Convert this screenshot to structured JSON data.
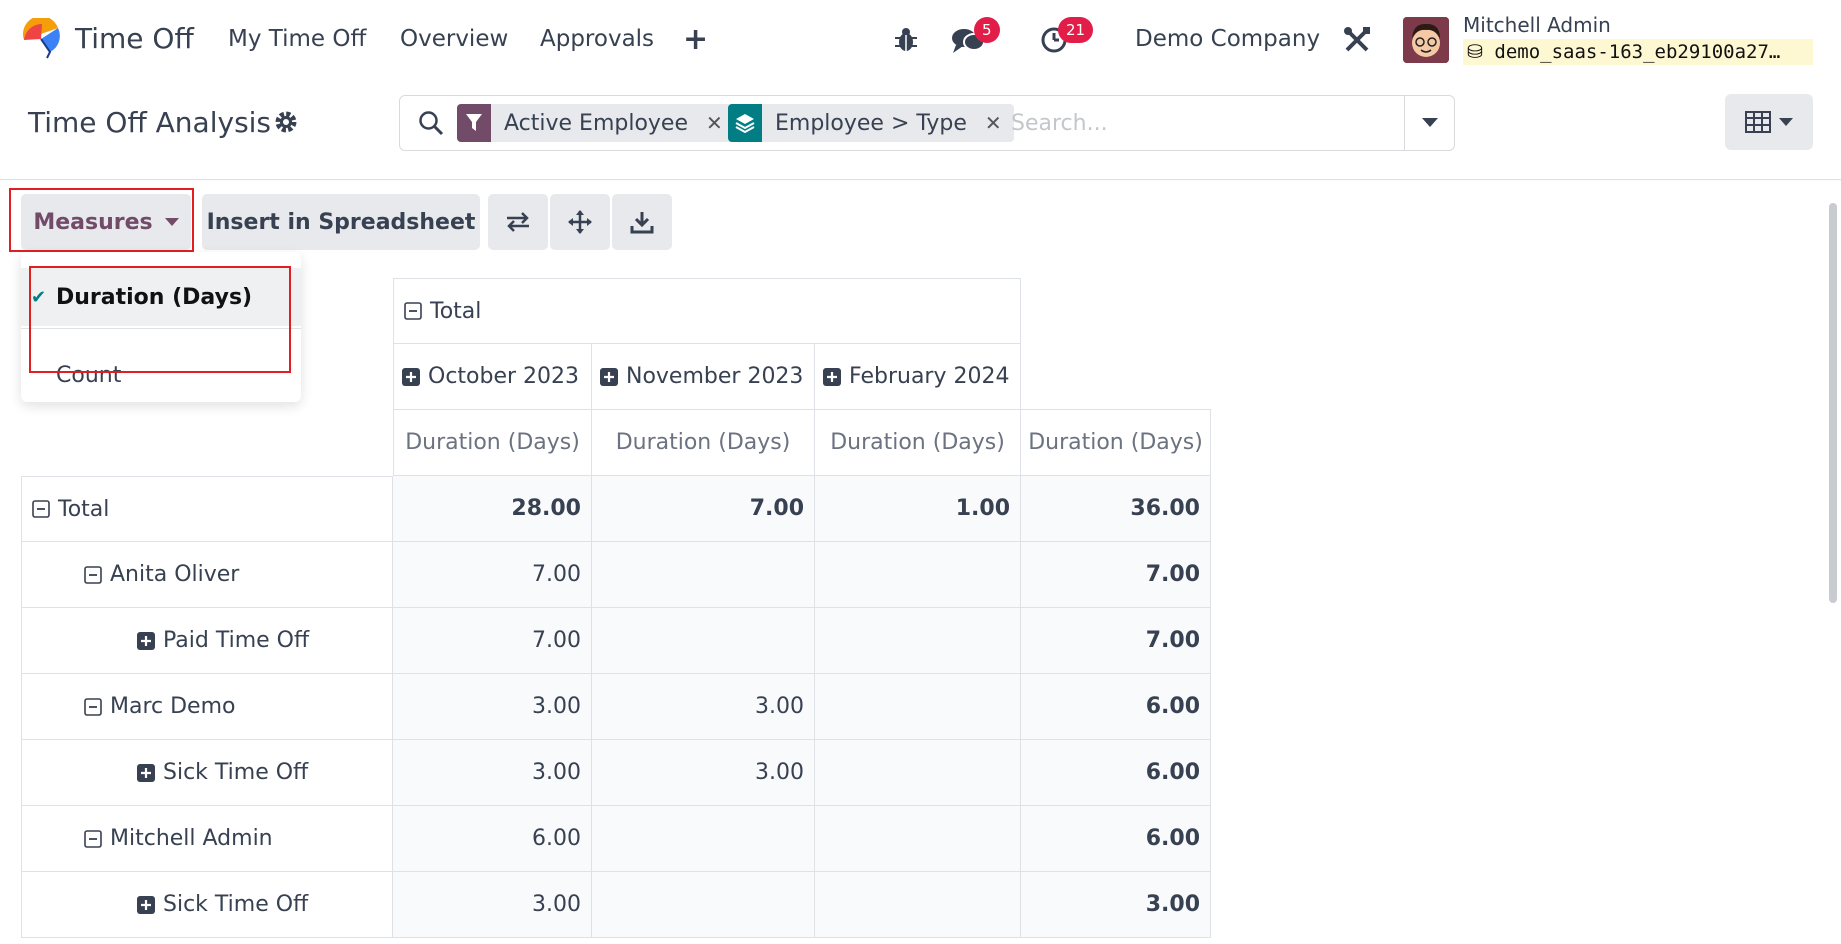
{
  "navbar": {
    "app_name": "Time Off",
    "menu": [
      "My Time Off",
      "Overview",
      "Approvals"
    ],
    "messages_count": "5",
    "activities_count": "21",
    "company": "Demo Company",
    "user_name": "Mitchell Admin",
    "database": "demo_saas-163_eb29100a27…"
  },
  "control": {
    "title": "Time Off Analysis",
    "facets": [
      {
        "label": "Active Employee",
        "icon": "filter-icon",
        "color": "#714b67"
      },
      {
        "label": "Employee > Type",
        "icon": "layers-icon",
        "color": "#017e84"
      }
    ],
    "search_placeholder": "Search..."
  },
  "toolbar": {
    "measures_label": "Measures",
    "insert_label": "Insert in Spreadsheet"
  },
  "measures_menu": {
    "items": [
      {
        "label": "Duration (Days)",
        "checked": true
      },
      {
        "label": "Count",
        "checked": false
      }
    ]
  },
  "pivot": {
    "col_total_header": "Total",
    "col_headers": [
      "October 2023",
      "November 2023",
      "February 2024"
    ],
    "measure_header": "Duration (Days)",
    "rows": [
      {
        "label": "Total",
        "level": 0,
        "toggle": "collapse",
        "values": [
          "28.00",
          "7.00",
          "1.00",
          "36.00"
        ],
        "bold": true
      },
      {
        "label": "Anita Oliver",
        "level": 1,
        "toggle": "collapse",
        "values": [
          "7.00",
          "",
          "",
          "7.00"
        ],
        "bold": false
      },
      {
        "label": "Paid Time Off",
        "level": 2,
        "toggle": "expand",
        "values": [
          "7.00",
          "",
          "",
          "7.00"
        ],
        "bold": false
      },
      {
        "label": "Marc Demo",
        "level": 1,
        "toggle": "collapse",
        "values": [
          "3.00",
          "3.00",
          "",
          "6.00"
        ],
        "bold": false
      },
      {
        "label": "Sick Time Off",
        "level": 2,
        "toggle": "expand",
        "values": [
          "3.00",
          "3.00",
          "",
          "6.00"
        ],
        "bold": false
      },
      {
        "label": "Mitchell Admin",
        "level": 1,
        "toggle": "collapse",
        "values": [
          "6.00",
          "",
          "",
          "6.00"
        ],
        "bold": false
      },
      {
        "label": "Sick Time Off",
        "level": 2,
        "toggle": "expand",
        "values": [
          "3.00",
          "",
          "",
          "3.00"
        ],
        "bold": false
      }
    ]
  }
}
